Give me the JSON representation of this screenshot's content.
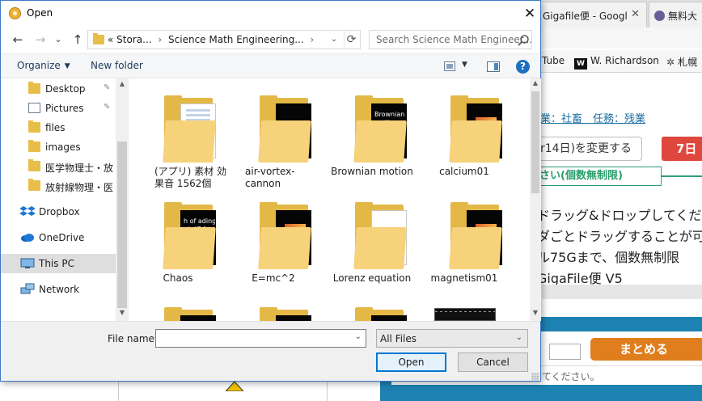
{
  "background": {
    "tabs": [
      {
        "label": "Gigafile便 - Googl",
        "close": "✕"
      },
      {
        "label": "無料大",
        "close": ""
      }
    ],
    "bookmarks": [
      {
        "label": "Tube"
      },
      {
        "label": "W. Richardson"
      },
      {
        "label": "札幌"
      }
    ],
    "page": {
      "line1": "業：社畜　任務：残業",
      "change_period": "r14日)を変更する",
      "days_badge": "7日",
      "unlimited": "さい(個数無制限)",
      "drop_lines": [
        "ドラッグ&ドロップしてくだ",
        "ダごとドラッグすることが可",
        "ル75Gまで、個数無制限",
        " GigaFile便 V5"
      ],
      "combine_button": "まとめる",
      "hint": "てください。"
    }
  },
  "dialog": {
    "title": "Open",
    "close_icon": "✕",
    "nav": {
      "back": "←",
      "forward": "→",
      "recent": "⌄",
      "up": "↑"
    },
    "address": {
      "prefix": "«",
      "crumbs": [
        "Stora...",
        "Science Math Engineering..."
      ],
      "separator": "›",
      "dropdown": "⌄",
      "refresh": "⟳"
    },
    "search": {
      "placeholder": "Search Science Math Engineer..."
    },
    "commands": {
      "organize": "Organize",
      "organize_caret": "▼",
      "new_folder": "New folder",
      "view_caret": "▼",
      "help": "?"
    },
    "nav_pane": [
      {
        "label": "Desktop",
        "icon": "folder-icon",
        "pinned": true
      },
      {
        "label": "Pictures",
        "icon": "pictures-icon",
        "pinned": true
      },
      {
        "label": "files",
        "icon": "folder-icon",
        "pinned": false
      },
      {
        "label": "images",
        "icon": "folder-icon",
        "pinned": false
      },
      {
        "label": "医学物理士・放",
        "icon": "folder-icon",
        "pinned": false
      },
      {
        "label": "放射線物理・医",
        "icon": "folder-icon",
        "pinned": false
      },
      {
        "label": "Dropbox",
        "icon": "dropbox-icon",
        "pinned": false
      },
      {
        "label": "OneDrive",
        "icon": "onedrive-icon",
        "pinned": false
      },
      {
        "label": "This PC",
        "icon": "this-pc-icon",
        "pinned": false,
        "selected": true
      },
      {
        "label": "Network",
        "icon": "network-icon",
        "pinned": false
      }
    ],
    "pin_glyph": "📌",
    "files": [
      {
        "name": "(アプリ) 素材 効果音 1562個",
        "thumb": "document"
      },
      {
        "name": "air-vortex-cannon",
        "thumb": "dark-glow"
      },
      {
        "name": "Brownian motion",
        "thumb": "dark-text",
        "paper_text": "Brownian motion a random"
      },
      {
        "name": "calcium01",
        "thumb": "image"
      },
      {
        "name": "Chaos",
        "thumb": "dark-text",
        "paper_text": "h of ading gh (C fract"
      },
      {
        "name": "E=mc^2",
        "thumb": "image"
      },
      {
        "name": "Lorenz equation",
        "thumb": "white-doc"
      },
      {
        "name": "magnetism01",
        "thumb": "image"
      },
      {
        "name": "",
        "thumb": "dark"
      },
      {
        "name": "",
        "thumb": "dark"
      },
      {
        "name": "",
        "thumb": "dark"
      }
    ],
    "filename": {
      "label": "File name:",
      "value": "",
      "caret": "⌄"
    },
    "filetype": {
      "value": "All Files",
      "caret": "⌄"
    },
    "buttons": {
      "open": "Open",
      "cancel": "Cancel"
    },
    "scroll": {
      "up": "▲",
      "down": "▼"
    }
  }
}
